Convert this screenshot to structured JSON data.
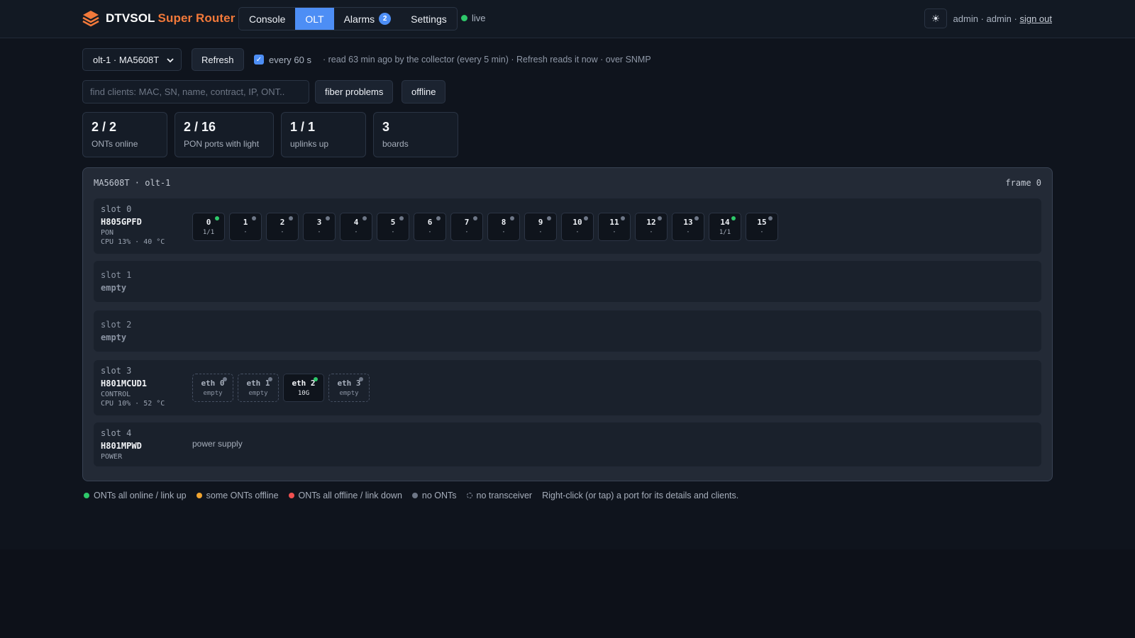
{
  "brand": {
    "name_a": "DTVSOL",
    "name_b": "Super Router",
    "accent": "#f2793a"
  },
  "nav": [
    {
      "label": "Console",
      "active": false
    },
    {
      "label": "OLT",
      "active": true
    },
    {
      "label": "Alarms",
      "active": false,
      "badge": "2"
    },
    {
      "label": "Settings",
      "active": false
    }
  ],
  "status": {
    "live_label": "live",
    "live_color": "#2ec86a"
  },
  "user": {
    "text": "admin · admin · ",
    "signout": "sign out",
    "theme_icon": "sun-icon"
  },
  "toolbar": {
    "olt_select": "olt-1 · MA5608T",
    "refresh": "Refresh",
    "auto_checked": true,
    "auto_label": "every 60 s",
    "note": "· read 63 min ago by the collector (every 5 min) · Refresh reads it now · over SNMP",
    "search_placeholder": "find clients: MAC, SN, name, contract, IP, ONT..",
    "fiber_problems": "fiber problems",
    "offline": "offline"
  },
  "stats": [
    {
      "value": "2 / 2",
      "label": "ONTs online"
    },
    {
      "value": "2 / 16",
      "label": "PON ports with light"
    },
    {
      "value": "1 / 1",
      "label": "uplinks up"
    },
    {
      "value": "3",
      "label": "boards"
    }
  ],
  "chassis": {
    "title": "MA5608T · olt-1",
    "frame": "frame 0",
    "slot0": {
      "name": "slot 0",
      "model": "H805GPFD",
      "type": "PON",
      "cpu": "CPU 13% · 40 °C",
      "ports": [
        {
          "n": "0",
          "c": "1/1",
          "up": true
        },
        {
          "n": "1",
          "c": "·",
          "up": false
        },
        {
          "n": "2",
          "c": "·",
          "up": false
        },
        {
          "n": "3",
          "c": "·",
          "up": false
        },
        {
          "n": "4",
          "c": "·",
          "up": false
        },
        {
          "n": "5",
          "c": "·",
          "up": false
        },
        {
          "n": "6",
          "c": "·",
          "up": false
        },
        {
          "n": "7",
          "c": "·",
          "up": false
        },
        {
          "n": "8",
          "c": "·",
          "up": false
        },
        {
          "n": "9",
          "c": "·",
          "up": false
        },
        {
          "n": "10",
          "c": "·",
          "up": false
        },
        {
          "n": "11",
          "c": "·",
          "up": false
        },
        {
          "n": "12",
          "c": "·",
          "up": false
        },
        {
          "n": "13",
          "c": "·",
          "up": false
        },
        {
          "n": "14",
          "c": "1/1",
          "up": true
        },
        {
          "n": "15",
          "c": "·",
          "up": false
        }
      ]
    },
    "slot1": {
      "name": "slot 1",
      "model": "empty"
    },
    "slot2": {
      "name": "slot 2",
      "model": "empty"
    },
    "slot3": {
      "name": "slot 3",
      "model": "H801MCUD1",
      "type": "CONTROL",
      "cpu": "CPU 10% · 52 °C",
      "eth": [
        {
          "n": "eth 0",
          "c": "empty",
          "up": false
        },
        {
          "n": "eth 1",
          "c": "empty",
          "up": false
        },
        {
          "n": "eth 2",
          "c": "10G",
          "up": true
        },
        {
          "n": "eth 3",
          "c": "empty",
          "up": false
        }
      ]
    },
    "slot4": {
      "name": "slot 4",
      "model": "H801MPWD",
      "type": "POWER",
      "note": "power supply"
    }
  },
  "legend": {
    "all_online": "ONTs all online / link up",
    "some_offline": "some ONTs offline",
    "all_offline": "ONTs all offline / link down",
    "no_onts": "no ONTs",
    "no_transceiver": "no transceiver",
    "hint": "Right-click (or tap) a port for its details and clients."
  }
}
